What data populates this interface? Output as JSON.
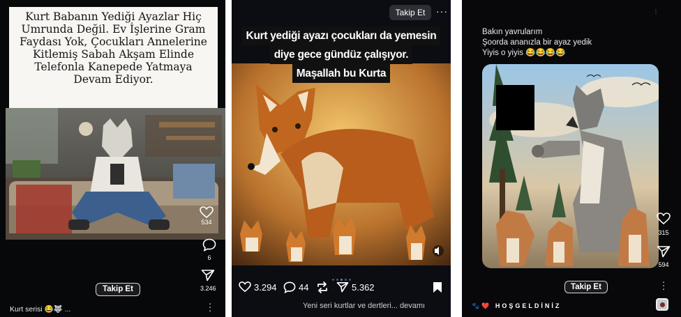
{
  "panel1": {
    "caption": "Kurt Babanın Yediği Ayazlar Hiç Umrunda Değil. Ev İşlerine Gram Faydası Yok, Çocukları Annelerine Kitlemiş Sabah Akşam Elinde Telefonla Kanepede Yatmaya Devam Ediyor.",
    "likes": "534",
    "comments": "6",
    "shares": "3.246",
    "follow_label": "Takip Et",
    "bottom_caption": "Kurt serisi 😂🐺 ..."
  },
  "panel2": {
    "follow_label": "Takip Et",
    "caption_lines": [
      "Kurt yediği ayazı çocukları da yemesin",
      "diye gece gündüz çalışıyor.",
      "Maşallah bu Kurta"
    ],
    "likes": "3.294",
    "comments": "44",
    "shares": "5.362",
    "bottom_caption": "Yeni seri kurtlar ve dertleri... devamı"
  },
  "panel3": {
    "caption_lines": [
      "Bakın yavrularım",
      "Şoorda ananızla bir ayaz yedik",
      "Yiyis o yiyis 😂😂😂😂"
    ],
    "likes": "315",
    "shares": "594",
    "follow_label": "Takip Et",
    "bottom_caption": "🐾❤️ HOŞGELDİNİZ"
  },
  "colors": {
    "accent_blue": "#3a8eff",
    "panel_bg": "#0c0c0e"
  }
}
